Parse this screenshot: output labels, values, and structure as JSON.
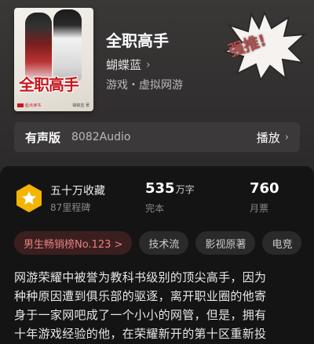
{
  "book": {
    "title": "全职高手",
    "author": "蝴蝶蓝",
    "genre": "游戏・虚拟网游",
    "cover": {
      "title": "全职高手",
      "publisher": "起点读书",
      "author": "蝴蝶蓝 著"
    }
  },
  "stamp": {
    "text": "强推!"
  },
  "audio": {
    "label": "有声版",
    "source": "8082Audio",
    "play_label": "播放"
  },
  "stats": {
    "collect": {
      "title": "五十万收藏",
      "sub": "87里程碑"
    },
    "words": {
      "value": "535",
      "unit": "万字",
      "sub": "完本"
    },
    "tickets": {
      "value": "760",
      "sub": "月票"
    }
  },
  "tags": [
    "男生畅销榜No.123 >",
    "技术流",
    "影视原著",
    "电竞"
  ],
  "description": [
    "网游荣耀中被誉为教科书级别的顶尖高手，因为",
    "种种原因遭到俱乐部的驱逐，离开职业圈的他寄",
    "身于一家网吧成了一个小小的网管，但是，拥有",
    "十年游戏经验的他，在荣耀新开的第十区重新投"
  ],
  "colors": {
    "accent_rank": "#e88080",
    "badge_gold": "#f5b400",
    "panel_bg": "#141414"
  }
}
